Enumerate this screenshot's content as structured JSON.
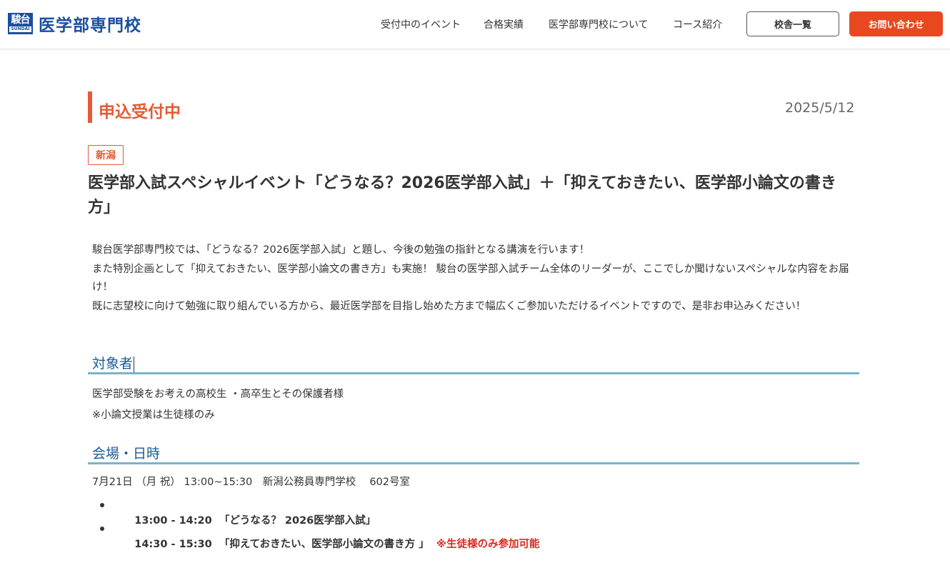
{
  "header": {
    "logo_badge_top": "駿台",
    "logo_badge_bottom": "SUNDAI",
    "logo_text": "医学部専門校",
    "nav": [
      {
        "label": "受付中のイベント"
      },
      {
        "label": "合格実績"
      },
      {
        "label": "医学部専門校について"
      },
      {
        "label": "コース紹介"
      }
    ],
    "campus_button": "校舎一覧",
    "contact_button": "お問い合わせ"
  },
  "article": {
    "status": "申込受付中",
    "date": "2025/5/12",
    "region": "新潟",
    "title": "医学部入試スペシャルイベント「どうなる？2026医学部入試」＋「抑えておきたい、医学部小論文の書き方」",
    "intro": [
      "駿台医学部専門校では、「どうなる？2026医学部入試」と題し、今後の勉強の指針となる講演を行います！",
      "また特別企画として「抑えておきたい、医学部小論文の書き方」も実施！ 駿台の医学部入試チーム全体のリーダーが、ここでしか聞けないスペシャルな内容をお届け！",
      "既に志望校に向けて勉強に取り組んでいる方から、最近医学部を目指し始めた方まで幅広くご参加いただけるイベントですので、是非お申込みください！"
    ],
    "target_heading": "対象者",
    "target_lines": [
      "医学部受験をお考えの高校生 ・高卒生とその保護者様",
      "※小論文授業は生徒様のみ"
    ],
    "venue_heading": "会場・日時",
    "venue_line": "7月21日 （月 祝） 13:00~15:30　新潟公務員専門学校　 602号室",
    "sessions": [
      {
        "time": "13:00 - 14:20",
        "title": "「どうなる？ 2026医学部入試」",
        "note": ""
      },
      {
        "time": "14:30 - 15:30",
        "title": "「抑えておきたい、医学部小論文の書き方 」",
        "note": "※生徒様のみ参加可能"
      }
    ]
  },
  "colors": {
    "brand_blue": "#1a4fa0",
    "accent_orange": "#e25b36",
    "contact_button": "#e8481f",
    "section_heading": "#1a5a96",
    "section_rule": "#78b4c8",
    "note_red": "#d42b1e"
  }
}
